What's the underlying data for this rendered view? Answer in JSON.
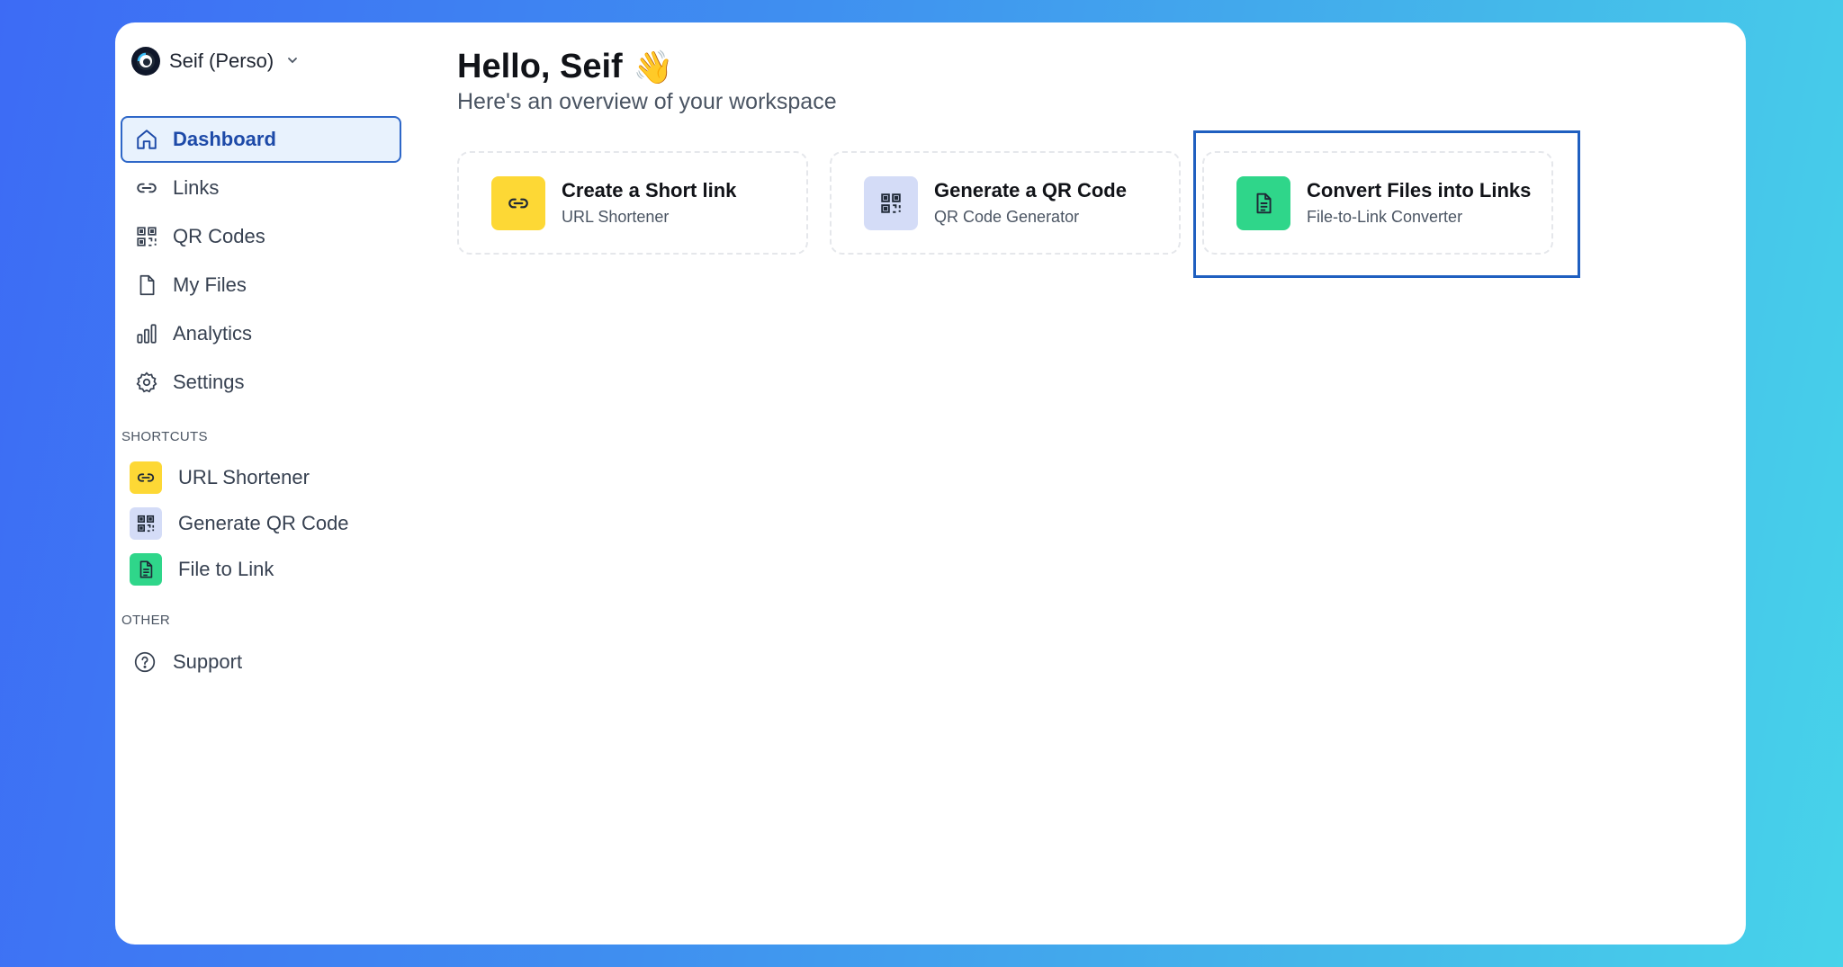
{
  "workspace": {
    "name": "Seif (Perso)",
    "icon": "workspace-logo",
    "caret": "chevron-down-icon"
  },
  "nav": [
    {
      "label": "Dashboard",
      "icon": "home-icon",
      "active": true
    },
    {
      "label": "Links",
      "icon": "link-icon"
    },
    {
      "label": "QR Codes",
      "icon": "qr-code-icon"
    },
    {
      "label": "My Files",
      "icon": "file-icon"
    },
    {
      "label": "Analytics",
      "icon": "bar-chart-icon"
    },
    {
      "label": "Settings",
      "icon": "gear-icon"
    }
  ],
  "shortcuts_label": "SHORTCUTS",
  "shortcuts": [
    {
      "label": "URL Shortener",
      "icon": "link-icon",
      "color": "#fdd835"
    },
    {
      "label": "Generate QR Code",
      "icon": "qr-code-icon",
      "color": "#d4dcf7"
    },
    {
      "label": "File to Link",
      "icon": "file-text-icon",
      "color": "#2fd68a"
    }
  ],
  "other_label": "OTHER",
  "other": [
    {
      "label": "Support",
      "icon": "help-circle-icon"
    }
  ],
  "main": {
    "greeting": "Hello, Seif",
    "wave": "👋",
    "subtitle": "Here's an overview of your workspace",
    "cards": [
      {
        "title": "Create a Short link",
        "subtitle": "URL Shortener",
        "icon": "link-icon",
        "color": "#fdd835"
      },
      {
        "title": "Generate a QR Code",
        "subtitle": "QR Code Generator",
        "icon": "qr-code-icon",
        "color": "#d4dcf7"
      },
      {
        "title": "Convert Files into Links",
        "subtitle": "File-to-Link Converter",
        "icon": "file-text-icon",
        "color": "#2fd68a"
      }
    ]
  },
  "colors": {
    "accent": "#2e67c8",
    "active_bg": "#e8f2fd",
    "highlight": "#1f5fc0"
  }
}
